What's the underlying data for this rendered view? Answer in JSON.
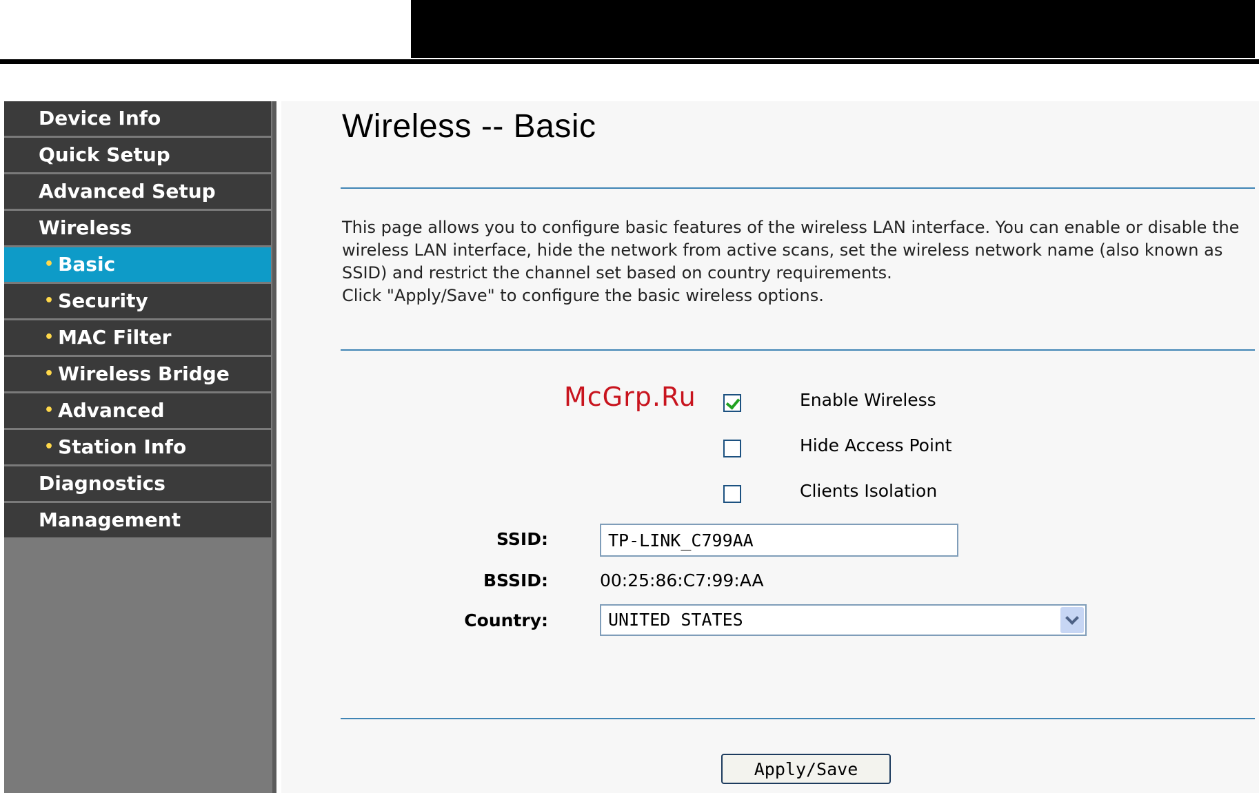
{
  "nav": {
    "items": [
      {
        "label": "Device Info"
      },
      {
        "label": "Quick Setup"
      },
      {
        "label": "Advanced Setup"
      },
      {
        "label": "Wireless"
      },
      {
        "label": "Basic"
      },
      {
        "label": "Security"
      },
      {
        "label": "MAC Filter"
      },
      {
        "label": "Wireless Bridge"
      },
      {
        "label": "Advanced"
      },
      {
        "label": "Station Info"
      },
      {
        "label": "Diagnostics"
      },
      {
        "label": "Management"
      }
    ],
    "bullet": "•",
    "active_color": "#0e9bc8"
  },
  "page": {
    "title": "Wireless -- Basic",
    "description": "This page allows you to configure basic features of the wireless LAN interface. You can enable or disable the wireless LAN interface, hide the network from active scans, set the wireless network name (also known as SSID) and restrict the channel set based on country requirements.",
    "instruction": "Click \"Apply/Save\" to configure the basic wireless options."
  },
  "watermark": "McGrp.Ru",
  "options": {
    "enable_wireless": {
      "label": "Enable Wireless",
      "checked": true
    },
    "hide_access_point": {
      "label": "Hide Access Point",
      "checked": false
    },
    "clients_isolation": {
      "label": "Clients Isolation",
      "checked": false
    }
  },
  "form": {
    "ssid_label": "SSID:",
    "ssid_value": "TP-LINK_C799AA",
    "bssid_label": "BSSID:",
    "bssid_value": "00:25:86:C7:99:AA",
    "country_label": "Country:",
    "country_value": "UNITED STATES"
  },
  "actions": {
    "apply_label": "Apply/Save"
  }
}
